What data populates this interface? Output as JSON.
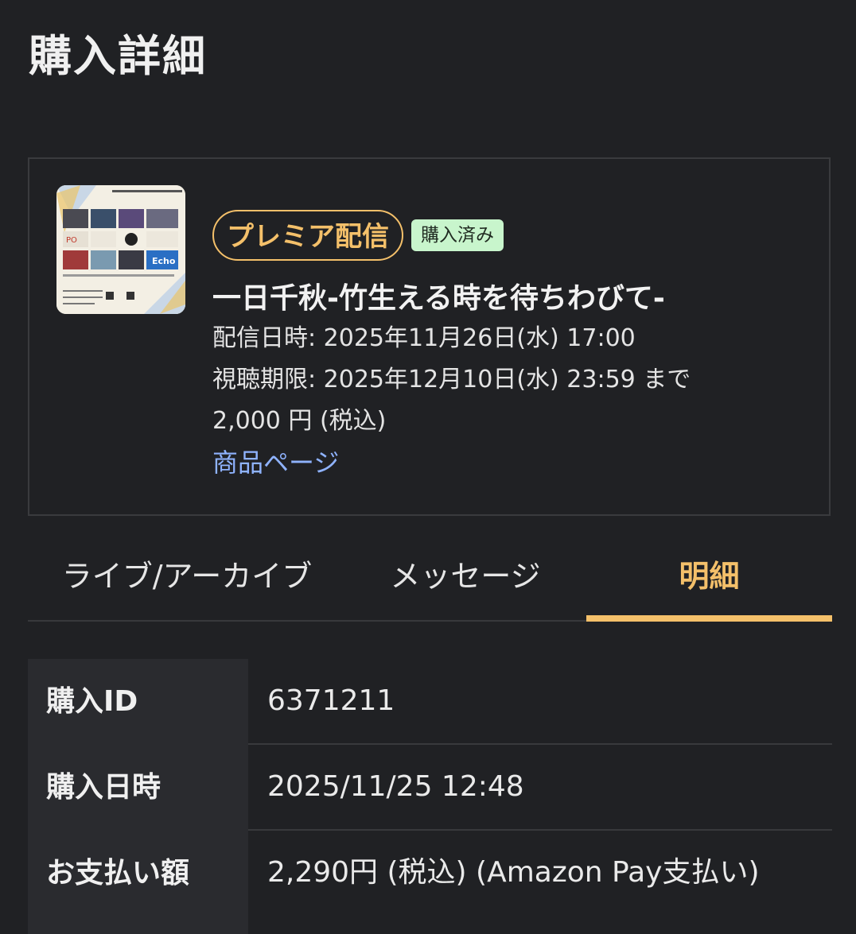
{
  "page": {
    "title": "購入詳細"
  },
  "product": {
    "thumbnail_icon": "event-flyer-image",
    "premiere_badge": "プレミア配信",
    "status_badge": "購入済み",
    "title": "一日千秋-竹生える時を待ちわびて-",
    "stream_datetime": "配信日時: 2025年11月26日(水) 17:00",
    "viewing_deadline": "視聴期限: 2025年12月10日(水) 23:59 まで",
    "price": "2,000 円 (税込)",
    "product_page_link": "商品ページ"
  },
  "tabs": [
    {
      "label": "ライブ/アーカイブ",
      "active": false
    },
    {
      "label": "メッセージ",
      "active": false
    },
    {
      "label": "明細",
      "active": true
    }
  ],
  "details": [
    {
      "label": "購入ID",
      "value": "6371211"
    },
    {
      "label": "購入日時",
      "value": "2025/11/25 12:48"
    },
    {
      "label": "お支払い額",
      "value": "2,290円 (税込) (Amazon Pay支払い)"
    }
  ],
  "colors": {
    "background": "#202124",
    "accent": "#f4c06a",
    "link": "#8fb3ff",
    "purchased_badge_bg": "#c8f5cc"
  }
}
